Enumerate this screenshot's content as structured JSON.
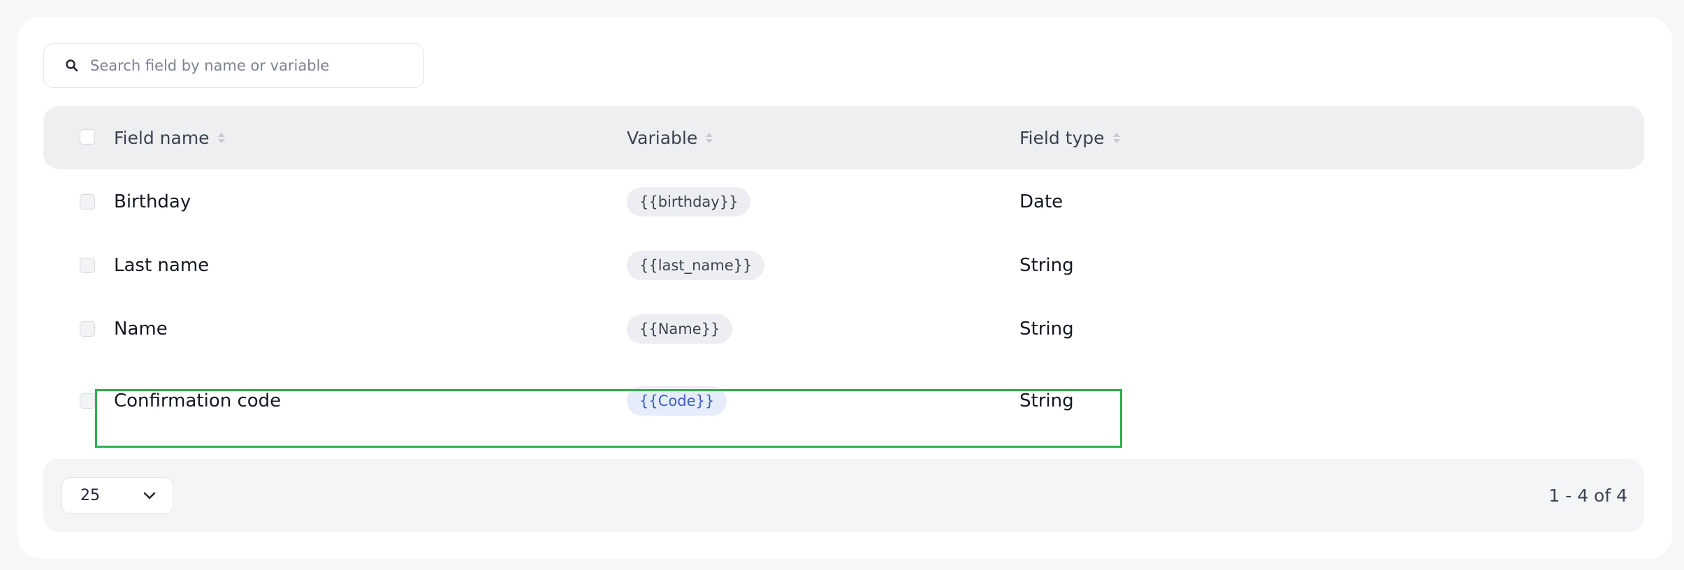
{
  "search": {
    "placeholder": "Search field by name or variable",
    "value": ""
  },
  "table": {
    "columns": [
      "Field name",
      "Variable",
      "Field type"
    ],
    "rows": [
      {
        "field_name": "Birthday",
        "variable": "{{birthday}}",
        "field_type": "Date"
      },
      {
        "field_name": "Last name",
        "variable": "{{last_name}}",
        "field_type": "String"
      },
      {
        "field_name": "Name",
        "variable": "{{Name}}",
        "field_type": "String"
      },
      {
        "field_name": "Confirmation code",
        "variable": "{{Code}}",
        "field_type": "String",
        "highlighted": true
      }
    ]
  },
  "footer": {
    "page_size": "25",
    "range": "1 - 4 of 4"
  },
  "colors": {
    "highlight": "#2db04b",
    "active_chip_text": "#3d5fc2",
    "active_chip_bg": "#e6ecfa"
  }
}
